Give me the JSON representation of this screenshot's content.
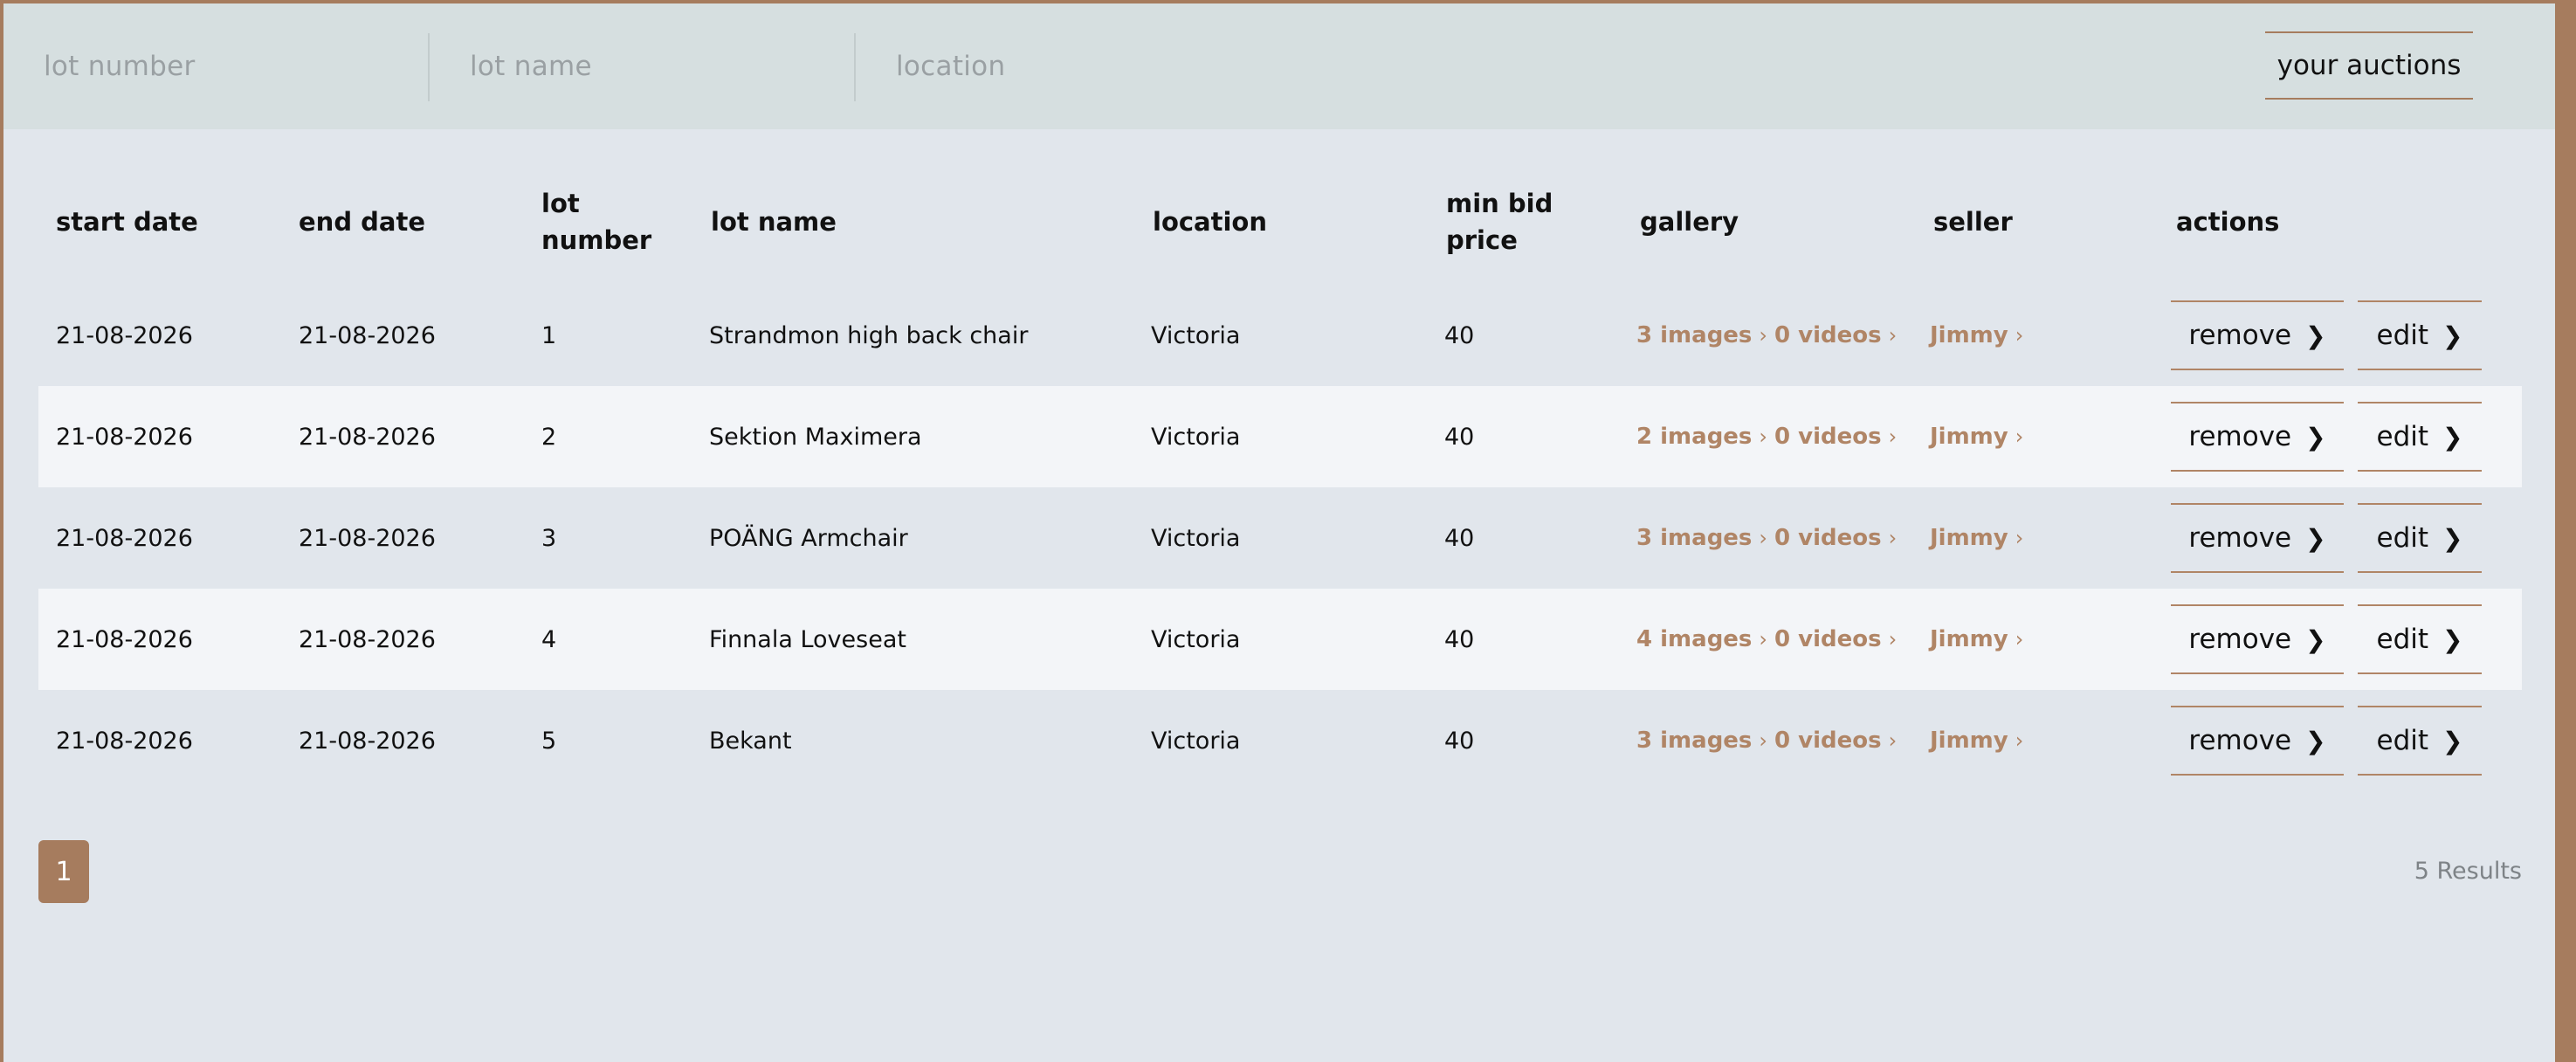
{
  "filters": {
    "lot_number_placeholder": "lot number",
    "lot_name_placeholder": "lot name",
    "location_placeholder": "location",
    "your_auctions_label": "your auctions"
  },
  "table": {
    "headers": {
      "start_date": "start date",
      "end_date": "end date",
      "lot_number": "lot number",
      "lot_name": "lot name",
      "location": "location",
      "min_bid_price": "min bid price",
      "gallery": "gallery",
      "seller": "seller",
      "actions": "actions"
    },
    "rows": [
      {
        "start_date": "21-08-2026",
        "end_date": "21-08-2026",
        "lot_number": "1",
        "lot_name": "Strandmon high back chair",
        "location": "Victoria",
        "min_bid_price": "40",
        "images": "3 images",
        "videos": "0 videos",
        "seller": "Jimmy",
        "remove": "remove",
        "edit": "edit"
      },
      {
        "start_date": "21-08-2026",
        "end_date": "21-08-2026",
        "lot_number": "2",
        "lot_name": "Sektion Maximera",
        "location": "Victoria",
        "min_bid_price": "40",
        "images": "2 images",
        "videos": "0 videos",
        "seller": "Jimmy",
        "remove": "remove",
        "edit": "edit"
      },
      {
        "start_date": "21-08-2026",
        "end_date": "21-08-2026",
        "lot_number": "3",
        "lot_name": "POÄNG Armchair",
        "location": "Victoria",
        "min_bid_price": "40",
        "images": "3 images",
        "videos": "0 videos",
        "seller": "Jimmy",
        "remove": "remove",
        "edit": "edit"
      },
      {
        "start_date": "21-08-2026",
        "end_date": "21-08-2026",
        "lot_number": "4",
        "lot_name": "Finnala Loveseat",
        "location": "Victoria",
        "min_bid_price": "40",
        "images": "4 images",
        "videos": "0 videos",
        "seller": "Jimmy",
        "remove": "remove",
        "edit": "edit"
      },
      {
        "start_date": "21-08-2026",
        "end_date": "21-08-2026",
        "lot_number": "5",
        "lot_name": "Bekant",
        "location": "Victoria",
        "min_bid_price": "40",
        "images": "3 images",
        "videos": "0 videos",
        "seller": "Jimmy",
        "remove": "remove",
        "edit": "edit"
      }
    ]
  },
  "pagination": {
    "current_page": "1",
    "results_text": "5 Results"
  },
  "colors": {
    "accent": "#a67c5e",
    "link": "#b08566",
    "background": "#e1e6ec",
    "filter_bar": "#d6dfe0",
    "alt_row": "#f3f5f8"
  }
}
